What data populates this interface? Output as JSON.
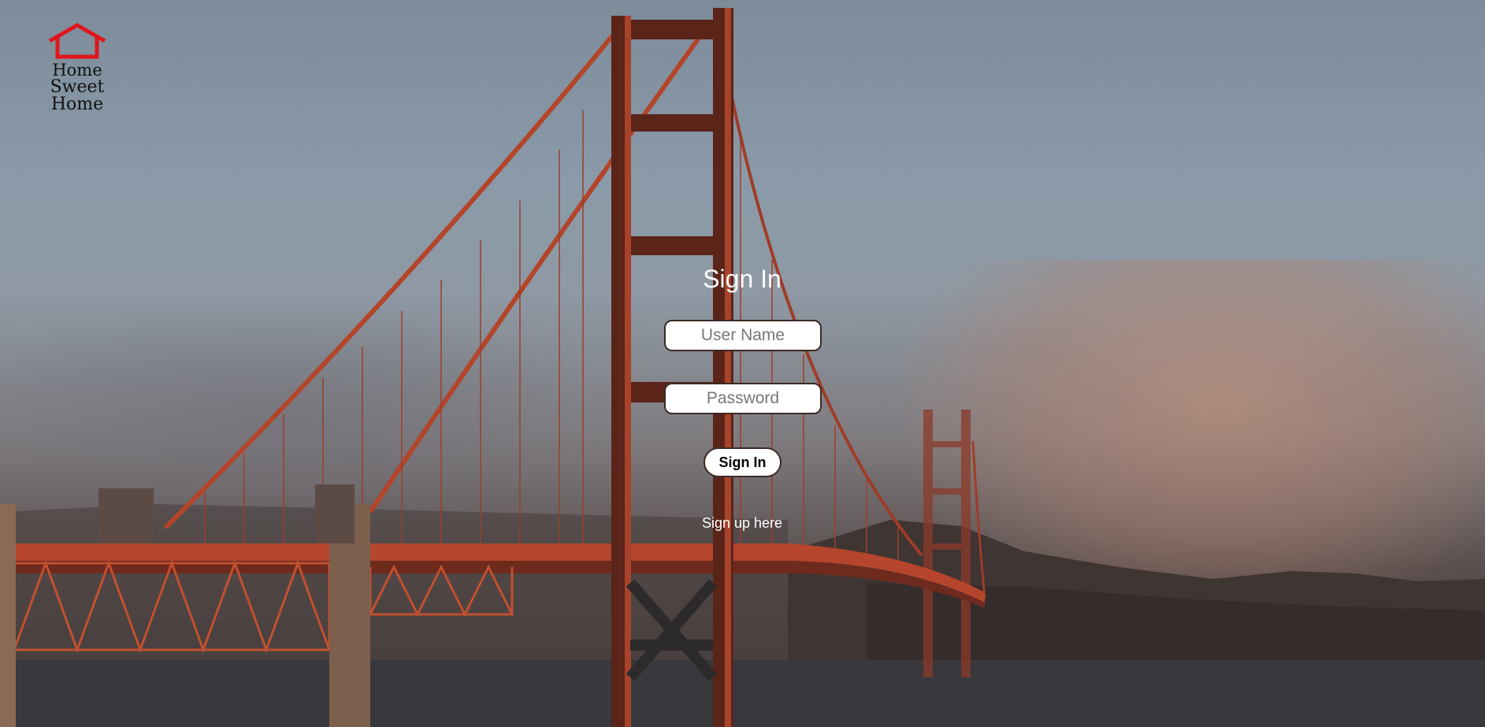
{
  "brand": {
    "line1": "Home",
    "line2": "Sweet Home",
    "icon": "house-icon",
    "icon_color": "#e0161c"
  },
  "form": {
    "title": "Sign In",
    "username_placeholder": "User Name",
    "password_placeholder": "Password",
    "submit_label": "Sign In",
    "signup_link": "Sign up here"
  },
  "background": {
    "subject": "bridge-scene",
    "bridge_color": "#b5452c"
  }
}
